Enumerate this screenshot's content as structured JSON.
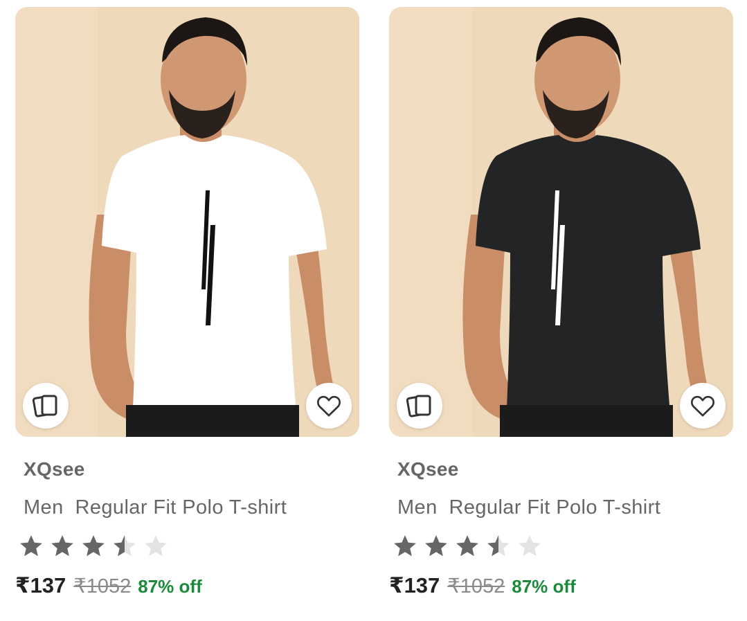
{
  "products": [
    {
      "brand": "XQsee",
      "title": "Men  Regular Fit Polo T-shirt",
      "rating": 3.5,
      "rating_max": 5,
      "price": "₹137",
      "mrp": "₹1052",
      "discount": "87% off",
      "shirt_color": "#ffffff",
      "print_color": "#111111"
    },
    {
      "brand": "XQsee",
      "title": "Men  Regular Fit Polo T-shirt",
      "rating": 3.5,
      "rating_max": 5,
      "price": "₹137",
      "mrp": "₹1052",
      "discount": "87% off",
      "shirt_color": "#222426",
      "print_color": "#ffffff"
    }
  ],
  "colors": {
    "background": "#efd9bb",
    "discount": "#1c8a3b",
    "star_filled": "#666666",
    "star_empty": "#e3e3e3"
  },
  "icons": {
    "similar": "cards-stack-icon",
    "wishlist": "heart-outline-icon"
  }
}
